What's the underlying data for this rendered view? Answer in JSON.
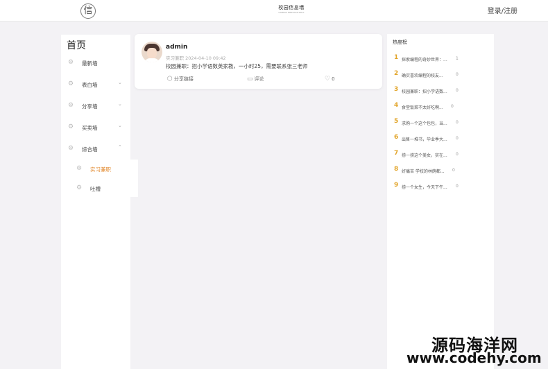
{
  "header": {
    "logo_char": "信",
    "site_title": "校园信息墙",
    "site_subtitle": "CAMPUS MESSAGE WALL",
    "login_label": "登录/注册"
  },
  "sidebar": {
    "title": "首页",
    "items": [
      {
        "label": "最新墙",
        "chevron": ""
      },
      {
        "label": "表白墙",
        "chevron": "⌄"
      },
      {
        "label": "分享墙",
        "chevron": "⌄"
      },
      {
        "label": "买卖墙",
        "chevron": "⌄"
      },
      {
        "label": "综合墙",
        "chevron": "⌃"
      }
    ],
    "subitems": [
      {
        "label": "实习兼职",
        "active": true
      },
      {
        "label": "吐槽",
        "active": false
      }
    ]
  },
  "post": {
    "username": "admin",
    "meta": "实习兼职 2024-04-10 09:42",
    "content": "校园兼职：招小学语数英家教，一小时25，需要联系张三老师",
    "share_label": "分享链接",
    "comment_label": "评论",
    "like_count": "0"
  },
  "hot": {
    "title": "热度榜",
    "items": [
      {
        "rank": "1",
        "text": "探索编程的奇妙世界：...",
        "count": "1"
      },
      {
        "rank": "2",
        "text": "确实喜欢编程的校友...",
        "count": "0"
      },
      {
        "rank": "3",
        "text": "校园兼职：招小学语数...",
        "count": "0"
      },
      {
        "rank": "4",
        "text": "食堂饭菜不太好吃啊...",
        "count": "0"
      },
      {
        "rank": "5",
        "text": "求购一个这个包包，当...",
        "count": "0"
      },
      {
        "rank": "6",
        "text": "出售一堆书，毕业季大...",
        "count": "0"
      },
      {
        "rank": "7",
        "text": "捞一捞这个美女，实在...",
        "count": "0"
      },
      {
        "rank": "8",
        "text": "好痛苦 学校的林荫都...",
        "count": "0"
      },
      {
        "rank": "9",
        "text": "捞一个女生，今天下午...",
        "count": "0"
      }
    ]
  },
  "watermark": {
    "line1": "源码海洋网",
    "line2": "www.codehy.com"
  },
  "colors": {
    "accent": "#e2882c",
    "rank": "#e2a52b",
    "background": "#f3f2f5"
  }
}
